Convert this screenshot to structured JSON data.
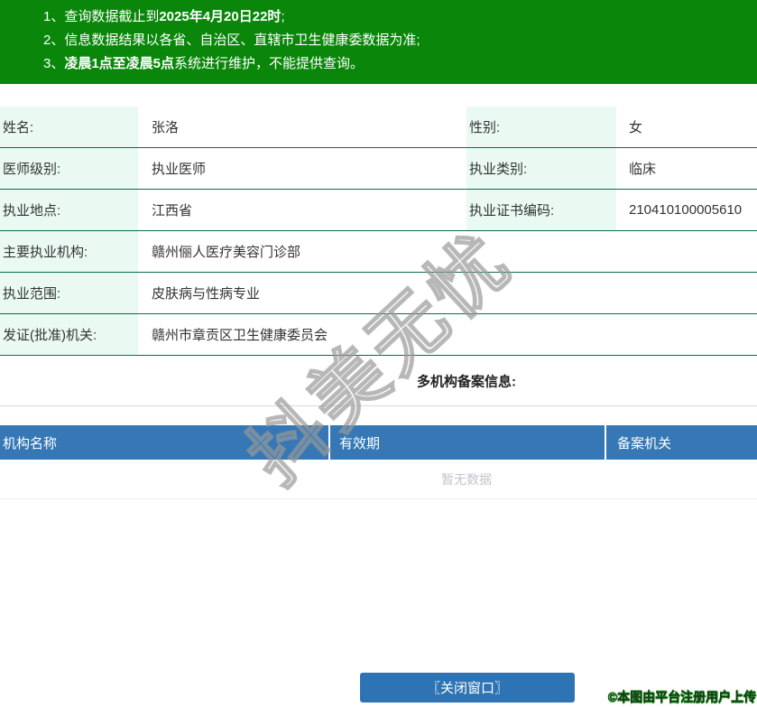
{
  "banner": {
    "line1_pre": "1、查询数据截止到",
    "line1_bold": "2025年4月20日22时",
    "line1_post": ";",
    "line2": "2、信息数据结果以各省、自治区、直辖市卫生健康委数据为准;",
    "line3_pre": "3、",
    "line3_bold": "凌晨1点至凌晨5点",
    "line3_post": "系统进行维护，不能提供查询。"
  },
  "info": {
    "pair_rows": [
      {
        "label1": "姓名:",
        "value1": "张洛",
        "label2": "性别:",
        "value2": "女"
      },
      {
        "label1": "医师级别:",
        "value1": "执业医师",
        "label2": "执业类别:",
        "value2": "临床"
      },
      {
        "label1": "执业地点:",
        "value1": "江西省",
        "label2": "执业证书编码:",
        "value2": "210410100005610"
      }
    ],
    "full_rows": [
      {
        "label": "主要执业机构:",
        "value": "赣州俪人医疗美容门诊部"
      },
      {
        "label": "执业范围:",
        "value": "皮肤病与性病专业"
      },
      {
        "label": "发证(批准)机关:",
        "value": "赣州市章贡区卫生健康委员会"
      }
    ]
  },
  "filing": {
    "title": "多机构备案信息:",
    "columns": [
      "机构名称",
      "有效期",
      "备案机关"
    ],
    "empty_text": "暂无数据"
  },
  "watermark": {
    "text": "抖美无忧"
  },
  "footer": {
    "close_button": "〖关闭窗口〗",
    "copyright": "©本图由平台注册用户上传"
  },
  "colors": {
    "banner_green": "#0a870a",
    "row_border_green": "#0c6b4f",
    "label_bg_mint": "#eafaf2",
    "table_header_blue": "#3578b5",
    "button_blue": "#2e74b5",
    "empty_text_gray": "#c0c4cc"
  }
}
